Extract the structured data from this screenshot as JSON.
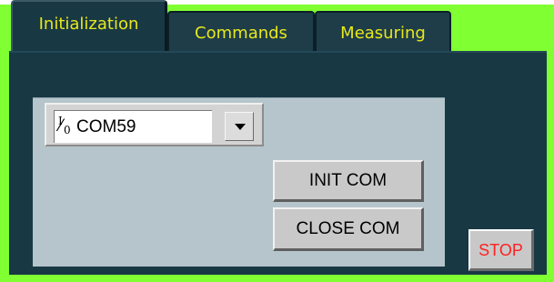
{
  "tabs": [
    {
      "label": "Initialization",
      "active": true
    },
    {
      "label": "Commands",
      "active": false
    },
    {
      "label": "Measuring",
      "active": false
    }
  ],
  "serial": {
    "io_icon_top": "I",
    "io_icon_bottom": "0",
    "port_value": "COM59"
  },
  "buttons": {
    "init_label": "INIT COM",
    "close_label": "CLOSE COM",
    "stop_label": "STOP"
  },
  "colors": {
    "tab_text": "#e8e81a",
    "tab_bg": "#183844",
    "frame_green": "#80ff33",
    "panel_bg": "#b5c5cb",
    "stop_text": "#ff2020"
  }
}
